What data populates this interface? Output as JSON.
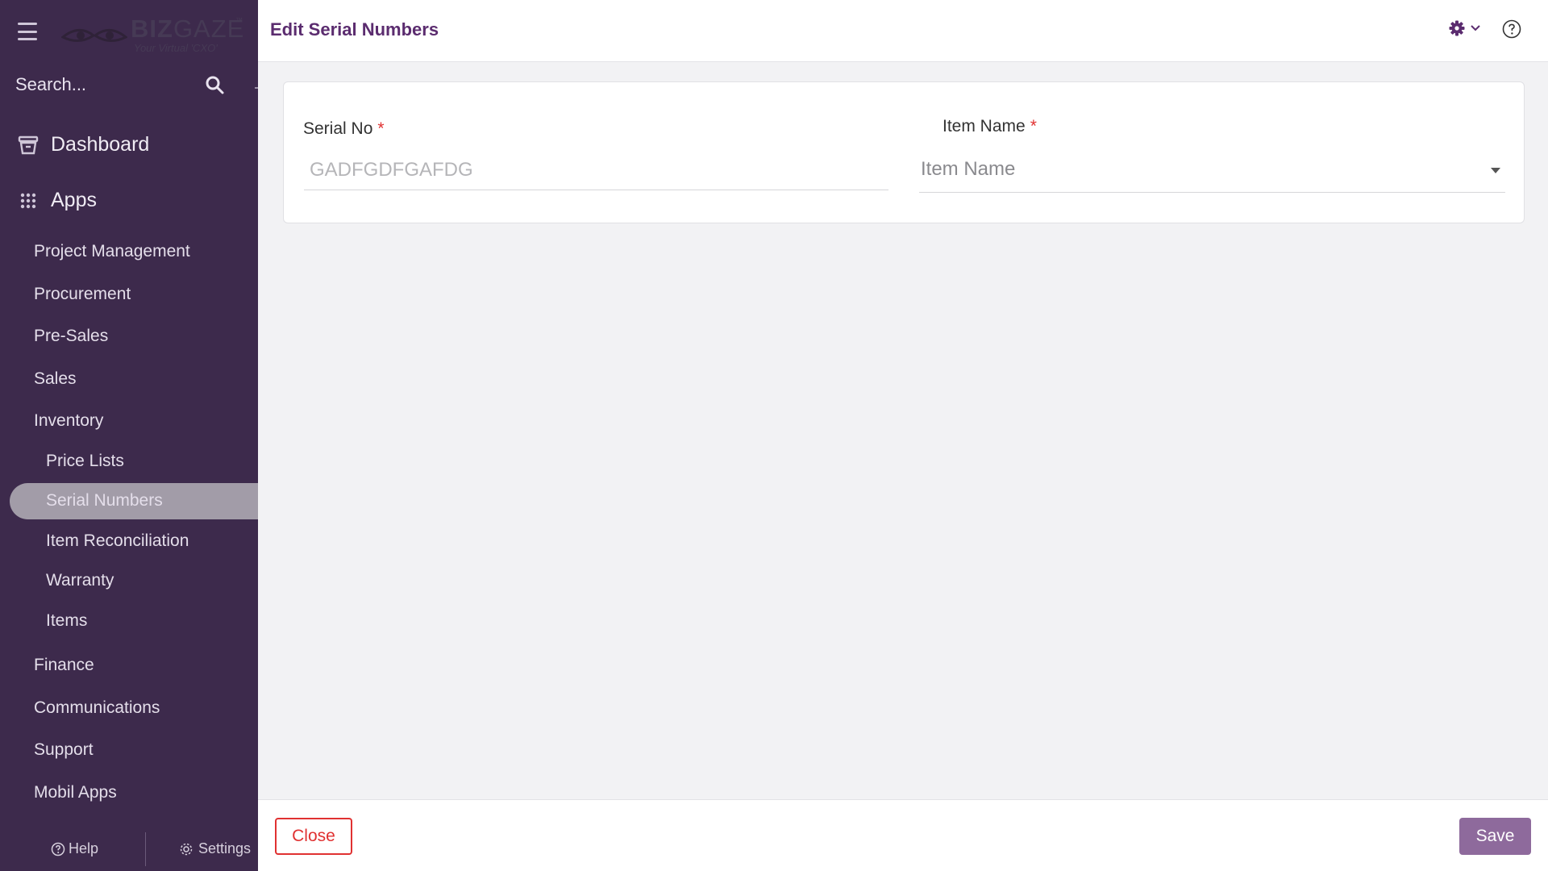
{
  "sidebar": {
    "logo": {
      "brand_bold": "BIZ",
      "brand_light": "GAZE",
      "trademark": "™",
      "tagline": "Your Virtual 'CXO'"
    },
    "search_placeholder": "Search...",
    "dashboard_label": "Dashboard",
    "apps_label": "Apps",
    "items": [
      {
        "label": "Project Management"
      },
      {
        "label": "Procurement"
      },
      {
        "label": "Pre-Sales"
      },
      {
        "label": "Sales"
      },
      {
        "label": "Inventory"
      }
    ],
    "inventory_sub": [
      {
        "label": "Price Lists"
      },
      {
        "label": "Serial Numbers",
        "active": true
      },
      {
        "label": "Item Reconciliation"
      },
      {
        "label": "Warranty"
      },
      {
        "label": "Items"
      }
    ],
    "items_after": [
      {
        "label": "Finance"
      },
      {
        "label": "Communications"
      },
      {
        "label": "Support"
      },
      {
        "label": "Mobil Apps"
      }
    ],
    "help_label": "Help",
    "settings_label": "Settings"
  },
  "header": {
    "title": "Edit Serial Numbers"
  },
  "form": {
    "serial_no": {
      "label": "Serial No",
      "required_mark": "*",
      "value": "GADFGDFGAFDG"
    },
    "item_name": {
      "label": "Item Name",
      "required_mark": "*",
      "placeholder": "Item Name"
    }
  },
  "footer": {
    "close_label": "Close",
    "save_label": "Save"
  },
  "colors": {
    "sidebar_bg": "#3d2a4c",
    "accent": "#5b2c6f",
    "save_button": "#8e6a9c",
    "close_button": "#e03131",
    "active_item_bg": "#a29ca8"
  },
  "icons": [
    "hamburger-icon",
    "search-icon",
    "dashboard-icon",
    "apps-grid-icon",
    "help-circle-icon",
    "settings-gear-icon",
    "chevron-down-icon"
  ]
}
